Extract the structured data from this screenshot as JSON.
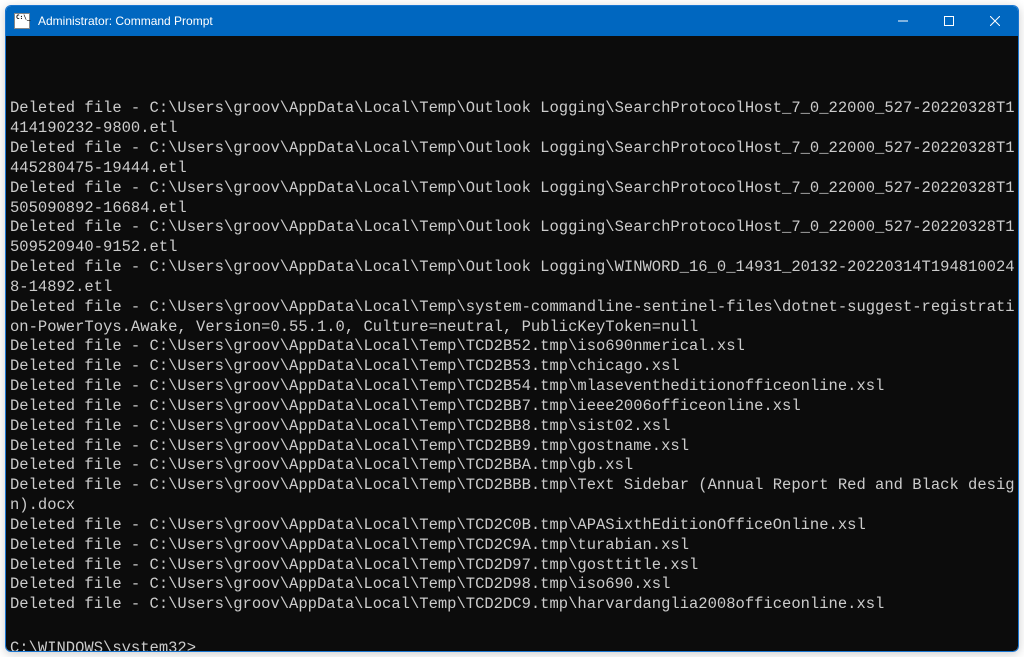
{
  "window": {
    "title": "Administrator: Command Prompt"
  },
  "lines": [
    "Deleted file - C:\\Users\\groov\\AppData\\Local\\Temp\\Outlook Logging\\SearchProtocolHost_7_0_22000_527-20220328T1414190232-9800.etl",
    "Deleted file - C:\\Users\\groov\\AppData\\Local\\Temp\\Outlook Logging\\SearchProtocolHost_7_0_22000_527-20220328T1445280475-19444.etl",
    "Deleted file - C:\\Users\\groov\\AppData\\Local\\Temp\\Outlook Logging\\SearchProtocolHost_7_0_22000_527-20220328T1505090892-16684.etl",
    "Deleted file - C:\\Users\\groov\\AppData\\Local\\Temp\\Outlook Logging\\SearchProtocolHost_7_0_22000_527-20220328T1509520940-9152.etl",
    "Deleted file - C:\\Users\\groov\\AppData\\Local\\Temp\\Outlook Logging\\WINWORD_16_0_14931_20132-20220314T1948100248-14892.etl",
    "Deleted file - C:\\Users\\groov\\AppData\\Local\\Temp\\system-commandline-sentinel-files\\dotnet-suggest-registration-PowerToys.Awake, Version=0.55.1.0, Culture=neutral, PublicKeyToken=null",
    "Deleted file - C:\\Users\\groov\\AppData\\Local\\Temp\\TCD2B52.tmp\\iso690nmerical.xsl",
    "Deleted file - C:\\Users\\groov\\AppData\\Local\\Temp\\TCD2B53.tmp\\chicago.xsl",
    "Deleted file - C:\\Users\\groov\\AppData\\Local\\Temp\\TCD2B54.tmp\\mlaseventheditionofficeonline.xsl",
    "Deleted file - C:\\Users\\groov\\AppData\\Local\\Temp\\TCD2BB7.tmp\\ieee2006officeonline.xsl",
    "Deleted file - C:\\Users\\groov\\AppData\\Local\\Temp\\TCD2BB8.tmp\\sist02.xsl",
    "Deleted file - C:\\Users\\groov\\AppData\\Local\\Temp\\TCD2BB9.tmp\\gostname.xsl",
    "Deleted file - C:\\Users\\groov\\AppData\\Local\\Temp\\TCD2BBA.tmp\\gb.xsl",
    "Deleted file - C:\\Users\\groov\\AppData\\Local\\Temp\\TCD2BBB.tmp\\Text Sidebar (Annual Report Red and Black design).docx",
    "Deleted file - C:\\Users\\groov\\AppData\\Local\\Temp\\TCD2C0B.tmp\\APASixthEditionOfficeOnline.xsl",
    "Deleted file - C:\\Users\\groov\\AppData\\Local\\Temp\\TCD2C9A.tmp\\turabian.xsl",
    "Deleted file - C:\\Users\\groov\\AppData\\Local\\Temp\\TCD2D97.tmp\\gosttitle.xsl",
    "Deleted file - C:\\Users\\groov\\AppData\\Local\\Temp\\TCD2D98.tmp\\iso690.xsl",
    "Deleted file - C:\\Users\\groov\\AppData\\Local\\Temp\\TCD2DC9.tmp\\harvardanglia2008officeonline.xsl"
  ],
  "prompt": "C:\\WINDOWS\\system32>"
}
